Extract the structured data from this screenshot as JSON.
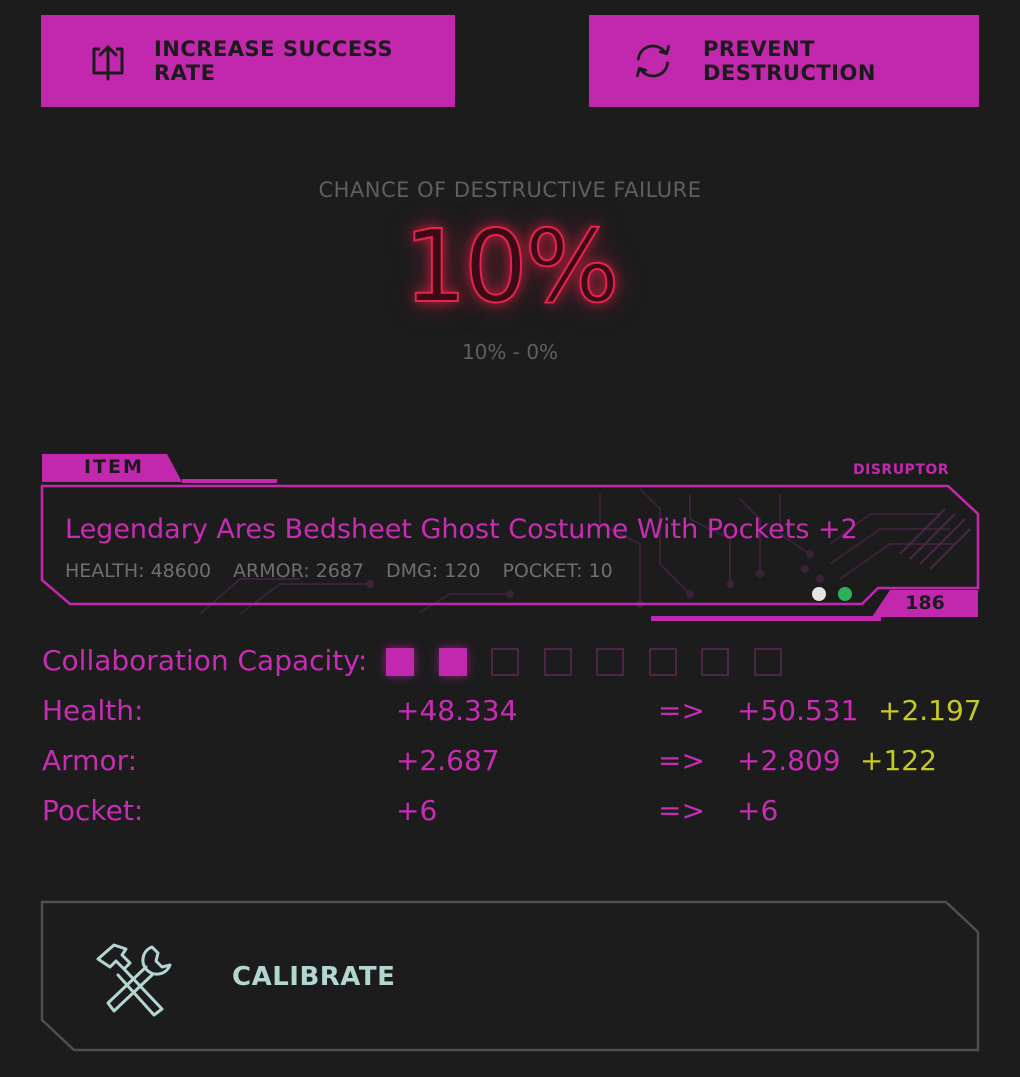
{
  "buttons": {
    "increase_success": "INCREASE SUCCESS RATE",
    "prevent_destruction": "PREVENT DESTRUCTION"
  },
  "chance": {
    "label": "CHANCE OF DESTRUCTIVE FAILURE",
    "value": "10%",
    "range": "10% - 0%"
  },
  "item": {
    "tab_label": "ITEM",
    "type": "DISRUPTOR",
    "name": "Legendary Ares Bedsheet Ghost Costume With Pockets +2",
    "stats": {
      "health": "HEALTH: 48600",
      "armor": "ARMOR: 2687",
      "dmg": "DMG: 120",
      "pocket": "POCKET: 10"
    },
    "level": "186"
  },
  "collaboration": {
    "label": "Collaboration Capacity:",
    "filled": 2,
    "total": 8
  },
  "stats": {
    "health": {
      "label": "Health:",
      "current": "+48.334",
      "arrow": "=>",
      "next": "+50.531",
      "diff": "+2.197"
    },
    "armor": {
      "label": "Armor:",
      "current": "+2.687",
      "arrow": "=>",
      "next": "+2.809",
      "diff": "+122"
    },
    "pocket": {
      "label": "Pocket:",
      "current": "+6",
      "arrow": "=>",
      "next": "+6",
      "diff": ""
    }
  },
  "calibrate": {
    "label": "CALIBRATE"
  },
  "colors": {
    "background": "#1c1c1d",
    "accent": "#c228ad",
    "danger": "#e3244c",
    "bonus": "#c5c924",
    "calibrate_text": "#b3d6d0"
  },
  "icons": [
    "share-upload-icon",
    "refresh-cycle-icon",
    "hammer-wrench-icon"
  ]
}
